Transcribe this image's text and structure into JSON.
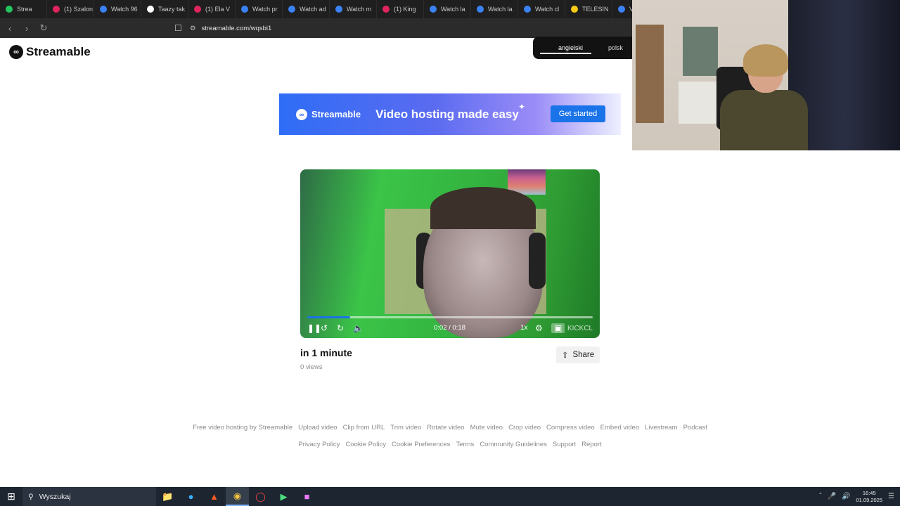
{
  "browser": {
    "tabs": [
      {
        "label": "Strea",
        "color": "#22c55e"
      },
      {
        "label": "(1) Szalon",
        "color": "#e0245e"
      },
      {
        "label": "Watch 96",
        "color": "#3b82f6"
      },
      {
        "label": "Taazy tak",
        "color": "#ffffff"
      },
      {
        "label": "(1) Ela V",
        "color": "#e0245e"
      },
      {
        "label": "Watch pr",
        "color": "#3b82f6"
      },
      {
        "label": "Watch ad",
        "color": "#3b82f6"
      },
      {
        "label": "Watch m",
        "color": "#3b82f6"
      },
      {
        "label": "(1) King",
        "color": "#e0245e"
      },
      {
        "label": "Watch la",
        "color": "#3b82f6"
      },
      {
        "label": "Watch la",
        "color": "#3b82f6"
      },
      {
        "label": "Watch cl",
        "color": "#3b82f6"
      },
      {
        "label": "TELESIN",
        "color": "#facc15"
      },
      {
        "label": "V",
        "color": "#3b82f6"
      }
    ],
    "url": "streamable.com/wqsbi1"
  },
  "page": {
    "logo_text": "Streamable",
    "languages": {
      "active": "angielski",
      "other": "polsk"
    },
    "banner": {
      "brand": "Streamable",
      "headline": "Video hosting made easy",
      "cta": "Get started"
    },
    "player": {
      "time": "0:02 / 0:18",
      "speed": "1x",
      "progress": 0.15,
      "buffered": 0.15,
      "watermark": "KICKCL"
    },
    "video": {
      "title": "in 1 minute",
      "views": "0 views",
      "share_label": "Share"
    },
    "footer": {
      "row1": [
        "Free video hosting by Streamable",
        "Upload video",
        "Clip from URL",
        "Trim video",
        "Rotate video",
        "Mute video",
        "Crop video",
        "Compress video",
        "Embed video",
        "Livestream",
        "Podcast"
      ],
      "row2": [
        "Privacy Policy",
        "Cookie Policy",
        "Cookie Preferences",
        "Terms",
        "Community Guidelines",
        "Support",
        "Report"
      ]
    }
  },
  "taskbar": {
    "search_placeholder": "Wyszukaj",
    "time": "16:45",
    "date": "01.09.2025"
  }
}
